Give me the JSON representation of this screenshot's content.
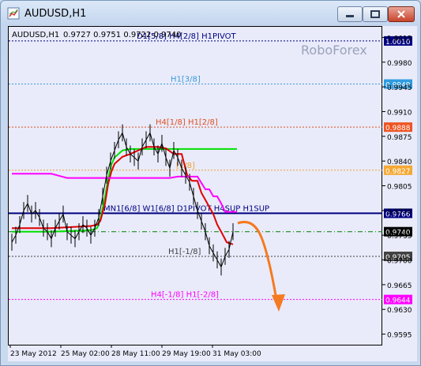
{
  "window": {
    "title": "AUDUSD,H1",
    "minimize_icon": "minimize-icon",
    "maximize_icon": "maximize-icon",
    "close_icon": "close-icon"
  },
  "chart_info": {
    "symbol_tf": "AUDUSD,H1",
    "ohlc": "0.9727 0.9751 0.9722 0.9740",
    "watermark": "RoboForex"
  },
  "colors": {
    "background": "#e9ebfa",
    "candles": "#000000",
    "ma_green": "#00e000",
    "ma_red": "#e00000",
    "ma_magenta": "#ff00ff",
    "arrow": "#f57a20"
  },
  "levels": [
    {
      "label": "D1[5/8] H4[2/8] H1PIVOT",
      "price": 1.001,
      "tag": "1.0010",
      "color": "#000080",
      "tag_bg": "#000080",
      "tag_fg": "#ffffff",
      "style": "dotted"
    },
    {
      "label": "H1[3/8]",
      "price": 0.9949,
      "tag": "0.9949",
      "color": "#3a9ad9",
      "tag_bg": "#2f9be0",
      "tag_fg": "#ffffff",
      "style": "dotted"
    },
    {
      "label": "H4[1/8] H1[2/8]",
      "price": 0.9888,
      "tag": "0.9888",
      "color": "#e05020",
      "tag_bg": "#ee5522",
      "tag_fg": "#ffffff",
      "style": "dotted"
    },
    {
      "label": "[1/8]",
      "price": 0.9827,
      "tag": "0.9827",
      "color": "#f0a030",
      "tag_bg": "#f5a833",
      "tag_fg": "#ffffff",
      "style": "dotted"
    },
    {
      "label": "MN1[6/8] W1[6/8] D1PIVOT H4SUP H1SUP",
      "price": 0.9766,
      "tag": "0.9766",
      "color": "#000080",
      "tag_bg": "#000080",
      "tag_fg": "#ffffff",
      "style": "solid"
    },
    {
      "label": "",
      "price": 0.974,
      "tag": "0.9740",
      "color": "#008000",
      "tag_bg": "#000000",
      "tag_fg": "#ffffff",
      "style": "dashdot"
    },
    {
      "label": "H1[-1/8]",
      "price": 0.9705,
      "tag": "0.9705",
      "color": "#404040",
      "tag_bg": "#404040",
      "tag_fg": "#ffffff",
      "style": "dotted"
    },
    {
      "label": "H4[-1/8] H1[-2/8]",
      "price": 0.9644,
      "tag": "0.9644",
      "color": "#ff00ff",
      "tag_bg": "#ff00ff",
      "tag_fg": "#ffffff",
      "style": "dotted"
    }
  ],
  "price_axis": [
    "1.0015",
    "0.9980",
    "0.9945",
    "0.9910",
    "0.9875",
    "0.9840",
    "0.9805",
    "0.9770",
    "0.9735",
    "0.9700",
    "0.9665",
    "0.9630",
    "0.9595"
  ],
  "time_axis": [
    "23 May 2012",
    "25 May 02:00",
    "28 May 11:00",
    "29 May 19:00",
    "31 May 03:00"
  ],
  "chart_data": {
    "type": "line",
    "title": "AUDUSD,H1",
    "ylim": [
      0.958,
      1.003
    ],
    "series": [
      {
        "name": "",
        "color": "#00e000",
        "x": [
          0,
          50,
          100,
          108,
          112,
          118,
          122,
          126,
          130,
          140,
          150,
          160,
          170,
          200,
          215,
          230,
          240,
          250,
          265,
          285
        ],
        "values": [
          0.974,
          0.974,
          0.9742,
          0.9745,
          0.9758,
          0.979,
          0.9815,
          0.9835,
          0.9845,
          0.9855,
          0.9857,
          0.9857,
          0.9857,
          0.9857,
          0.9857,
          0.9857,
          0.9857,
          0.9857,
          0.9857,
          0.9857
        ]
      },
      {
        "name": "",
        "color": "#e00000",
        "x": [
          0,
          50,
          100,
          108,
          112,
          118,
          122,
          126,
          130,
          140,
          150,
          160,
          170,
          185,
          195,
          205,
          215,
          222,
          228,
          235,
          240,
          245,
          250,
          255,
          260,
          265,
          272,
          280
        ],
        "values": [
          0.9745,
          0.9745,
          0.9748,
          0.975,
          0.9755,
          0.978,
          0.9808,
          0.9825,
          0.9836,
          0.9846,
          0.985,
          0.9855,
          0.986,
          0.986,
          0.9858,
          0.985,
          0.985,
          0.982,
          0.9812,
          0.9812,
          0.9795,
          0.9785,
          0.9775,
          0.9765,
          0.975,
          0.974,
          0.9725,
          0.9722
        ]
      },
      {
        "name": "",
        "color": "#ff00ff",
        "x": [
          0,
          50,
          60,
          70,
          80,
          90,
          100,
          120,
          140,
          160,
          180,
          200,
          210,
          220,
          235,
          245,
          250,
          255,
          260,
          265,
          270,
          275,
          285
        ],
        "values": [
          0.9822,
          0.9822,
          0.9819,
          0.9816,
          0.9816,
          0.9816,
          0.9816,
          0.9816,
          0.9816,
          0.9816,
          0.9816,
          0.9816,
          0.9818,
          0.9818,
          0.9818,
          0.98,
          0.98,
          0.979,
          0.979,
          0.978,
          0.9768,
          0.9768,
          0.9768
        ]
      },
      {
        "name": "",
        "color": "#000000",
        "x": [
          0,
          5,
          10,
          15,
          20,
          25,
          30,
          35,
          40,
          45,
          50,
          55,
          60,
          65,
          70,
          75,
          80,
          85,
          90,
          95,
          100,
          105,
          110,
          115,
          120,
          125,
          130,
          135,
          140,
          145,
          150,
          155,
          160,
          165,
          170,
          175,
          180,
          185,
          190,
          195,
          200,
          205,
          210,
          215,
          220,
          225,
          230,
          235,
          240,
          245,
          250,
          255,
          260,
          265,
          270,
          275,
          280
        ],
        "values": [
          0.9725,
          0.9735,
          0.975,
          0.977,
          0.978,
          0.9765,
          0.977,
          0.976,
          0.9745,
          0.974,
          0.973,
          0.9745,
          0.9755,
          0.9765,
          0.974,
          0.9735,
          0.973,
          0.974,
          0.975,
          0.9745,
          0.9735,
          0.9745,
          0.976,
          0.979,
          0.982,
          0.984,
          0.9855,
          0.987,
          0.988,
          0.986,
          0.985,
          0.9845,
          0.984,
          0.986,
          0.987,
          0.988,
          0.986,
          0.985,
          0.9865,
          0.9845,
          0.983,
          0.9855,
          0.9845,
          0.983,
          0.982,
          0.981,
          0.979,
          0.977,
          0.9755,
          0.974,
          0.972,
          0.971,
          0.97,
          0.969,
          0.9705,
          0.9715,
          0.974
        ]
      }
    ]
  }
}
